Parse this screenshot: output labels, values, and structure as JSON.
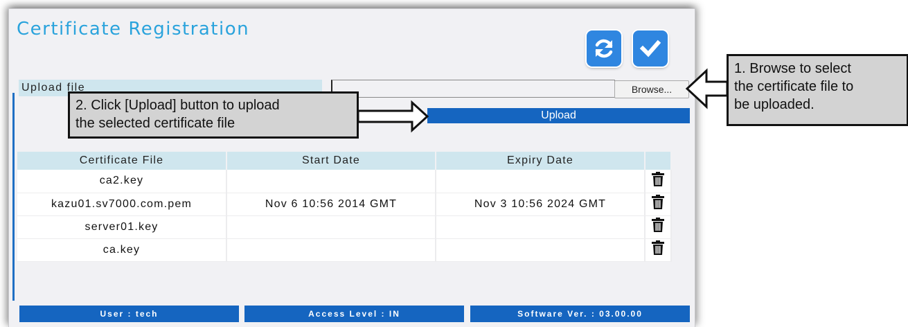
{
  "page": {
    "title": "Certificate Registration"
  },
  "toolbar": {
    "refresh_icon": "refresh-icon",
    "apply_icon": "check-icon",
    "colors": {
      "button": "#2f86e0",
      "accent": "#1565c0",
      "title": "#2aa3dc",
      "header_bg": "#cfe6ee"
    }
  },
  "upload": {
    "label": "Upload file",
    "file_value": "",
    "browse_label": "Browse...",
    "upload_label": "Upload"
  },
  "callouts": {
    "upload_line1": "2. Click [Upload] button to upload",
    "upload_line2": "the selected certificate file",
    "browse_line1": "1. Browse to select",
    "browse_line2": "the certificate file to",
    "browse_line3": "be uploaded."
  },
  "table": {
    "headers": [
      "Certificate File",
      "Start Date",
      "Expiry Date",
      ""
    ],
    "rows": [
      {
        "file": "ca2.key",
        "start": "",
        "expiry": ""
      },
      {
        "file": "kazu01.sv7000.com.pem",
        "start": "Nov 6 10:56 2014 GMT",
        "expiry": "Nov 3 10:56 2024 GMT"
      },
      {
        "file": "server01.key",
        "start": "",
        "expiry": ""
      },
      {
        "file": "ca.key",
        "start": "",
        "expiry": ""
      }
    ],
    "delete_icon": "trash-icon"
  },
  "status": {
    "user": "User : tech",
    "access_level": "Access Level : IN",
    "software_version": "Software Ver. : 03.00.00"
  }
}
